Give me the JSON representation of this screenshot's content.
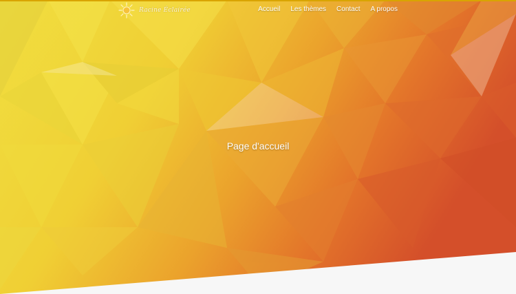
{
  "header": {
    "logo_text": "Racine Éclairée",
    "logo_icon": "sun-icon"
  },
  "nav": {
    "items": [
      {
        "label": "Accueil"
      },
      {
        "label": "Les thèmes"
      },
      {
        "label": "Contact"
      },
      {
        "label": "A propos"
      }
    ]
  },
  "hero": {
    "title": "Page d'accueil"
  },
  "colors": {
    "yellow": "#f2df3e",
    "gold": "#efc22e",
    "orange": "#ea8b2a",
    "red_orange": "#d9532a",
    "bottom_band": "#f7f7f7"
  }
}
